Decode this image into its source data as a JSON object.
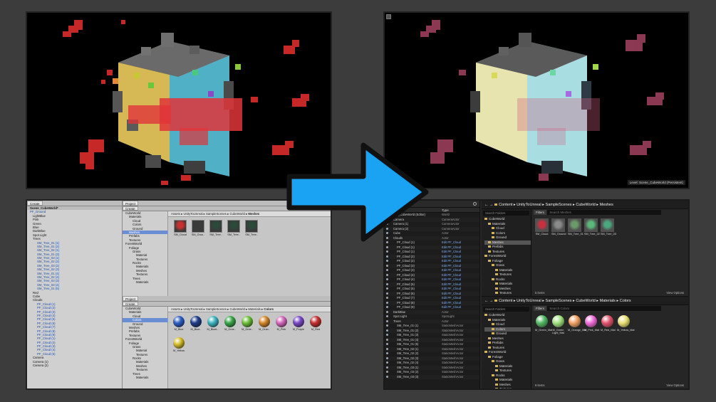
{
  "unity": {
    "hierarchy": {
      "create": "Create",
      "search": "",
      "rows": [
        {
          "text": "Scene_CubeWorld*",
          "style": "bold"
        },
        {
          "text": "PF_Ground",
          "style": "blue"
        },
        {
          "text": "LightBlue",
          "style": ""
        },
        {
          "text": "Pink",
          "style": ""
        },
        {
          "text": "Green",
          "style": ""
        },
        {
          "text": "Blue",
          "style": ""
        },
        {
          "text": "DarkBlue",
          "style": ""
        },
        {
          "text": "Spot Light",
          "style": ""
        },
        {
          "text": "Trees",
          "style": ""
        },
        {
          "text": "SM_Tree_01 (1)",
          "style": "blue"
        },
        {
          "text": "SM_Tree_01 (2)",
          "style": "blue"
        },
        {
          "text": "SM_Tree_02 (1)",
          "style": "blue"
        },
        {
          "text": "SM_Tree_01 (3)",
          "style": "blue"
        },
        {
          "text": "SM_Tree_03 (1)",
          "style": "blue"
        },
        {
          "text": "SM_Tree_02 (2)",
          "style": "blue"
        },
        {
          "text": "SM_Tree_03 (2)",
          "style": "blue"
        },
        {
          "text": "SM_Tree_02 (3)",
          "style": "blue"
        },
        {
          "text": "SM_Tree_01 (4)",
          "style": "blue"
        },
        {
          "text": "SM_Tree_02 (4)",
          "style": "blue"
        },
        {
          "text": "SM_Tree_03 (3)",
          "style": "blue"
        },
        {
          "text": "SM_Tree_03 (4)",
          "style": "blue"
        },
        {
          "text": "SM_Tree_01 (5)",
          "style": "blue"
        },
        {
          "text": "Red",
          "style": ""
        },
        {
          "text": "Cube",
          "style": ""
        },
        {
          "text": "Clouds",
          "style": ""
        },
        {
          "text": "PF_Cloud (1)",
          "style": "blue"
        },
        {
          "text": "PF_Cloud (2)",
          "style": "blue"
        },
        {
          "text": "PF_Cloud (3)",
          "style": "blue"
        },
        {
          "text": "PF_Cloud (4)",
          "style": "blue"
        },
        {
          "text": "PF_Cloud (5)",
          "style": "blue"
        },
        {
          "text": "PF_Cloud (6)",
          "style": "blue"
        },
        {
          "text": "PF_Cloud (7)",
          "style": "blue"
        },
        {
          "text": "PF_Cloud (8)",
          "style": "blue"
        },
        {
          "text": "PF_Cloud (9)",
          "style": "blue"
        },
        {
          "text": "PF_Cloud (1)",
          "style": "blue"
        },
        {
          "text": "PF_Cloud (2)",
          "style": "blue"
        },
        {
          "text": "PF_Cloud (3)",
          "style": "blue"
        },
        {
          "text": "PF_Cloud (4)",
          "style": "blue"
        },
        {
          "text": "PF_Cloud (5)",
          "style": "blue"
        },
        {
          "text": "Camera",
          "style": ""
        },
        {
          "text": "Camera (1)",
          "style": ""
        },
        {
          "text": "Camera (2)",
          "style": ""
        }
      ]
    },
    "project_tab": "Project",
    "create": "Create",
    "tree": [
      "CubeWorld",
      "Materials",
      "Cloud",
      "Colors",
      "Ground",
      "Meshes",
      "Prefabs",
      "Textures",
      "ForestWorld",
      "Foliage",
      "Grass",
      "Material",
      "Textures",
      "Rocks",
      "Materials",
      "Meshes",
      "Textures",
      "Trees",
      "Materials"
    ],
    "top_crumbs": [
      "Assets",
      "UnityToUnreal",
      "SampleScenes",
      "CubeWorld",
      "Meshes"
    ],
    "bottom_crumbs": [
      "Assets",
      "UnityToUnreal",
      "SampleScenes",
      "CubeWorld",
      "Materials",
      "Colors"
    ],
    "meshes": [
      "SM_Cloud",
      "SM_Grou..",
      "SM_Tree..",
      "SM_Tree..",
      "SM_Tree.."
    ],
    "materials": [
      {
        "name": "M_Blue",
        "color": "#2f5fc8"
      },
      {
        "name": "M_Blue..",
        "color": "#1f3d8a"
      },
      {
        "name": "M_BlueL..",
        "color": "#3fb8c4"
      },
      {
        "name": "M_Gree..",
        "color": "#3aa84a"
      },
      {
        "name": "M_Gree..",
        "color": "#6fc23a"
      },
      {
        "name": "M_Oran..",
        "color": "#d88a2a"
      },
      {
        "name": "M_Pink",
        "color": "#d86ac0"
      },
      {
        "name": "M_Purple",
        "color": "#7a4ac8"
      },
      {
        "name": "M_Red",
        "color": "#c83030"
      },
      {
        "name": "M_Yellow",
        "color": "#d8c02a"
      }
    ]
  },
  "unreal": {
    "level_label": "Level: Scene_CubeWorld (Persistent)",
    "outliner": {
      "type_header": "Type",
      "rows": [
        {
          "name": "Scene_CubeWorld (Editor)",
          "type": "World",
          "blue": false
        },
        {
          "name": "Camera",
          "type": "CameraActor",
          "blue": false
        },
        {
          "name": "Camera (1)",
          "type": "CameraActor",
          "blue": false
        },
        {
          "name": "Camera (2)",
          "type": "CameraActor",
          "blue": false
        },
        {
          "name": "Cube",
          "type": "Actor",
          "blue": false
        },
        {
          "name": "Clouds",
          "type": "Actor",
          "blue": false
        },
        {
          "name": "PF_Cloud (1)",
          "type": "Edit PF_Cloud",
          "blue": true
        },
        {
          "name": "PF_Cloud (1)",
          "type": "Edit PF_Cloud",
          "blue": true
        },
        {
          "name": "PF_Cloud (1)",
          "type": "Edit PF_Cloud",
          "blue": true
        },
        {
          "name": "PF_Cloud (2)",
          "type": "Edit PF_Cloud",
          "blue": true
        },
        {
          "name": "PF_Cloud (2)",
          "type": "Edit PF_Cloud",
          "blue": true
        },
        {
          "name": "PF_Cloud (3)",
          "type": "Edit PF_Cloud",
          "blue": true
        },
        {
          "name": "PF_Cloud (3)",
          "type": "Edit PF_Cloud",
          "blue": true
        },
        {
          "name": "PF_Cloud (4)",
          "type": "Edit PF_Cloud",
          "blue": true
        },
        {
          "name": "PF_Cloud (4)",
          "type": "Edit PF_Cloud",
          "blue": true
        },
        {
          "name": "PF_Cloud (5)",
          "type": "Edit PF_Cloud",
          "blue": true
        },
        {
          "name": "PF_Cloud (5)",
          "type": "Edit PF_Cloud",
          "blue": true
        },
        {
          "name": "PF_Cloud (6)",
          "type": "Edit PF_Cloud",
          "blue": true
        },
        {
          "name": "PF_Cloud (7)",
          "type": "Edit PF_Cloud",
          "blue": true
        },
        {
          "name": "PF_Cloud (8)",
          "type": "Edit PF_Cloud",
          "blue": true
        },
        {
          "name": "PF_Cloud (9)",
          "type": "Edit PF_Cloud",
          "blue": true
        },
        {
          "name": "DarkBlue",
          "type": "Actor",
          "blue": false
        },
        {
          "name": "Spot Light",
          "type": "SpotLight",
          "blue": false
        },
        {
          "name": "Trees",
          "type": "Actor",
          "blue": false
        },
        {
          "name": "SM_Tree_01 (1)",
          "type": "StaticMeshActor",
          "blue": false
        },
        {
          "name": "SM_Tree_01 (2)",
          "type": "StaticMeshActor",
          "blue": false
        },
        {
          "name": "SM_Tree_01 (3)",
          "type": "StaticMeshActor",
          "blue": false
        },
        {
          "name": "SM_Tree_01 (4)",
          "type": "StaticMeshActor",
          "blue": false
        },
        {
          "name": "SM_Tree_01 (5)",
          "type": "StaticMeshActor",
          "blue": false
        },
        {
          "name": "SM_Tree_02 (1)",
          "type": "StaticMeshActor",
          "blue": false
        },
        {
          "name": "SM_Tree_02 (2)",
          "type": "StaticMeshActor",
          "blue": false
        },
        {
          "name": "SM_Tree_02 (3)",
          "type": "StaticMeshActor",
          "blue": false
        },
        {
          "name": "SM_Tree_02 (4)",
          "type": "StaticMeshActor",
          "blue": false
        },
        {
          "name": "SM_Tree_03 (1)",
          "type": "StaticMeshActor",
          "blue": false
        },
        {
          "name": "SM_Tree_03 (2)",
          "type": "StaticMeshActor",
          "blue": false
        },
        {
          "name": "SM_Tree_03 (3)",
          "type": "StaticMeshActor",
          "blue": false
        }
      ]
    },
    "top": {
      "crumbs": [
        "Content",
        "UnityToUnreal",
        "SampleScenes",
        "CubeWorld",
        "Meshes"
      ],
      "search_folders": "Search Folders",
      "filters": "Filters",
      "search_meshes": "Search Meshes",
      "tree": [
        "CubeWorld",
        "Materials",
        "Cloud",
        "Colors",
        "Ground",
        "Meshes",
        "Prefabs",
        "Textures",
        "ForestWorld",
        "Foliage",
        "Grass",
        "Materials",
        "Textures",
        "Rocks",
        "Materials",
        "Meshes",
        "Textures",
        "Trees"
      ],
      "assets": [
        "SM_Cloud",
        "SM_Ground",
        "SM_Tree_01",
        "SM_Tree_02",
        "SM_Tree_03"
      ],
      "count": "5 items",
      "view_options": "View Options"
    },
    "bottom": {
      "crumbs": [
        "Content",
        "UnityToUnreal",
        "SampleScenes",
        "CubeWorld",
        "Materials",
        "Colors"
      ],
      "search_folders": "Search Folders",
      "filters": "Filters",
      "search_colors": "Search Colors",
      "tree": [
        "CubeWorld",
        "Materials",
        "Cloud",
        "Colors",
        "Ground",
        "Meshes",
        "Prefabs",
        "Textures",
        "ForestWorld",
        "Foliage",
        "Grass",
        "Materials",
        "Textures",
        "Rocks",
        "Materials",
        "Meshes",
        "Textures",
        "Trees"
      ],
      "assets": [
        {
          "name": "M_Green_Mat",
          "color": "#4fb860"
        },
        {
          "name": "M_Green Light_Mat",
          "color": "#9ee07a"
        },
        {
          "name": "M_Orange_Mat",
          "color": "#f0a060"
        },
        {
          "name": "M_Pink_Mat",
          "color": "#f06ad8"
        },
        {
          "name": "M_Red_Mat",
          "color": "#e0506a"
        },
        {
          "name": "M_Yellow_Mat",
          "color": "#e8e070"
        }
      ],
      "count": "6 items",
      "view_options": "View Options"
    }
  },
  "colors": {
    "arrow": "#1aa3f2",
    "arrow_outline": "#111111",
    "unity_bg": "#c2c2c2",
    "unreal_bg": "#262626"
  }
}
